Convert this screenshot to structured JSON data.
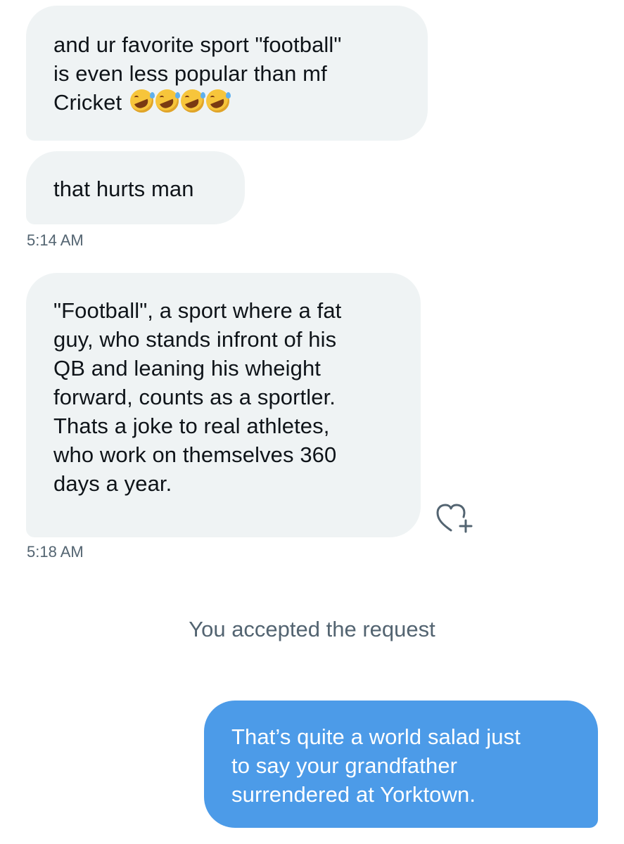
{
  "messages": [
    {
      "direction": "incoming",
      "lines": [
        "and ur favorite sport \"football\"",
        "is even less popular than mf",
        "Cricket"
      ],
      "emoji": [
        "rolling-on-floor-laughing",
        "rolling-on-floor-laughing",
        "rolling-on-floor-laughing",
        "rolling-on-floor-laughing"
      ]
    },
    {
      "direction": "incoming",
      "lines": [
        "that hurts man"
      ]
    },
    {
      "direction": "incoming",
      "lines": [
        "\"Football\", a sport where a fat",
        "guy, who stands infront of his",
        "QB and leaning his wheight",
        "forward, counts as a sportler.",
        "Thats a joke to real athletes,",
        "who work on themselves 360",
        "days a year."
      ]
    },
    {
      "direction": "outgoing",
      "lines": [
        "That’s quite a world salad just",
        "to say your grandfather",
        "surrendered at Yorktown."
      ]
    }
  ],
  "timestamps": [
    "5:14 AM",
    "5:18 AM"
  ],
  "system_notice": "You accepted the request",
  "icons": {
    "react": "heart-plus-icon",
    "emoji": "rolling-on-floor-laughing-emoji"
  },
  "colors": {
    "incoming_bubble": "#eff3f4",
    "outgoing_bubble": "#4c9be8",
    "meta_text": "#536471"
  }
}
